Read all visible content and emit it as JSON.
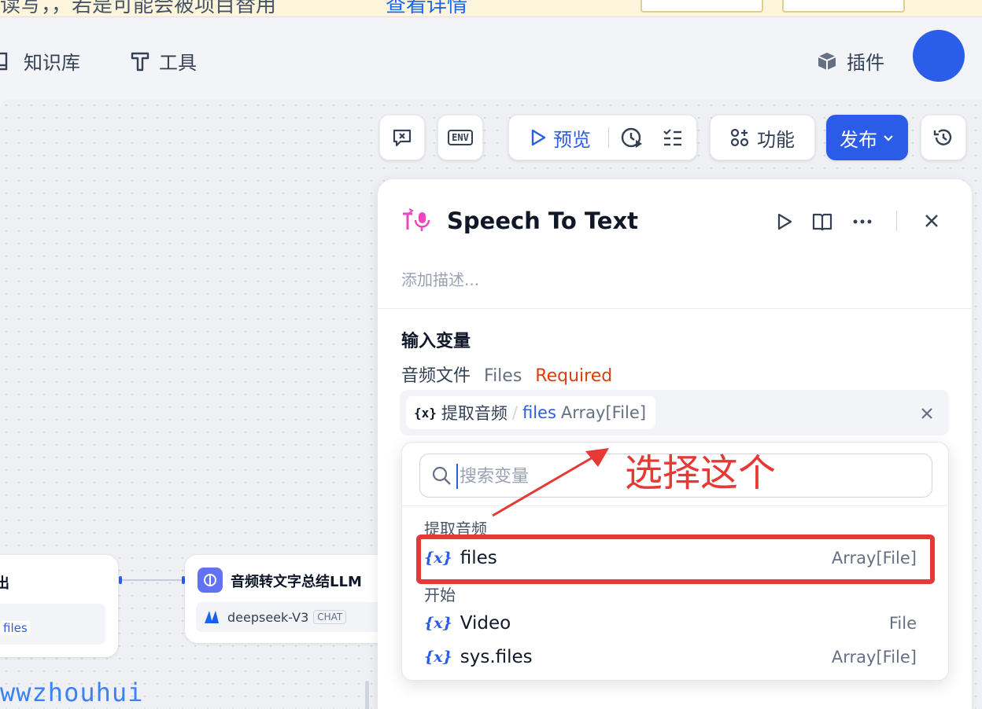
{
  "banner": {
    "text": "读写，，若是可能会被项目替用",
    "link": "查看详情"
  },
  "header": {
    "nav": [
      {
        "label": "知识库",
        "icon": "book-icon"
      },
      {
        "label": "工具",
        "icon": "hammer-icon"
      }
    ],
    "plugins_label": "插件"
  },
  "toolbar": {
    "preview_label": "预览",
    "features_label": "功能",
    "publish_label": "发布",
    "env_label": "ENV"
  },
  "canvas": {
    "left_node": {
      "title": "出",
      "chip": "files"
    },
    "llm_node": {
      "title": "音频转文字总结LLM",
      "model": "deepseek-V3",
      "badge": "CHAT"
    },
    "watermark": "wwzhouhui"
  },
  "panel": {
    "title": "Speech To Text",
    "description_placeholder": "添加描述...",
    "section_title": "输入变量",
    "field_label": "音频文件",
    "field_type": "Files",
    "field_required": "Required",
    "selected": {
      "node": "提取音频",
      "sep": "/",
      "var": "files",
      "type": "Array[File]"
    }
  },
  "dropdown": {
    "search_placeholder": "搜索变量",
    "groups": [
      {
        "label": "提取音频",
        "options": [
          {
            "name": "files",
            "type": "Array[File]"
          }
        ]
      },
      {
        "label": "开始",
        "options": [
          {
            "name": "Video",
            "type": "File"
          },
          {
            "name": "sys.files",
            "type": "Array[File]"
          }
        ]
      }
    ]
  },
  "annotation": "选择这个",
  "colors": {
    "accent": "#2a5ce8",
    "required": "#d93f0b",
    "annotation": "#e53935"
  }
}
